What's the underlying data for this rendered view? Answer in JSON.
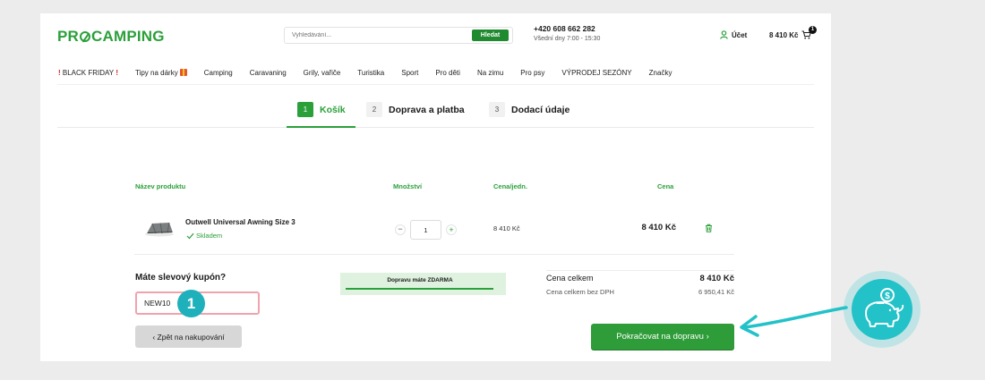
{
  "header": {
    "logo_text": "PROCAMPING",
    "logo_left": "PR",
    "logo_right": "CAMPING",
    "search": {
      "placeholder": "Vyhledávání...",
      "button": "Hledat"
    },
    "phone": "+420 608 662 282",
    "hours": "Všední dny 7:00 - 15:30",
    "account_label": "Účet",
    "cart_total": "8 410 Kč",
    "cart_count": "1"
  },
  "nav": {
    "black_friday": "BLACK FRIDAY",
    "items": [
      "Tipy na dárky",
      "Camping",
      "Caravaning",
      "Grily, vařiče",
      "Turistika",
      "Sport",
      "Pro děti",
      "Na zimu",
      "Pro psy",
      "VÝPRODEJ SEZÓNY",
      "Značky"
    ]
  },
  "steps": [
    {
      "num": "1",
      "label": "Košík"
    },
    {
      "num": "2",
      "label": "Doprava a platba"
    },
    {
      "num": "3",
      "label": "Dodací údaje"
    }
  ],
  "table": {
    "headers": {
      "product": "Název produktu",
      "qty": "Množství",
      "unit": "Cena/jedn.",
      "price": "Cena"
    },
    "rows": [
      {
        "name": "Outwell Universal Awning Size 3",
        "stock": "Skladem",
        "qty": "1",
        "unit_price": "8 410 Kč",
        "price": "8 410 Kč"
      }
    ]
  },
  "coupon": {
    "title": "Máte slevový kupón?",
    "value": "NEW10",
    "marker": "1"
  },
  "shipping": {
    "text": "Dopravu máte ZDARMA",
    "progress": 1.0
  },
  "summary": {
    "total_label": "Cena celkem",
    "total_value": "8 410 Kč",
    "novat_label": "Cena celkem bez DPH",
    "novat_value": "6 950,41 Kč"
  },
  "buttons": {
    "back": "‹  Zpět na nakupování",
    "continue": "Pokračovat na dopravu  ›"
  },
  "colors": {
    "brand_green": "#2ba03a",
    "annotation_teal": "#22c2c8",
    "coupon_border": "#f0a3ac"
  },
  "icons": {
    "account": "user-icon",
    "cart": "cart-icon",
    "delete": "trash-icon",
    "stock": "check-icon",
    "annotation": "piggy-bank-icon"
  }
}
